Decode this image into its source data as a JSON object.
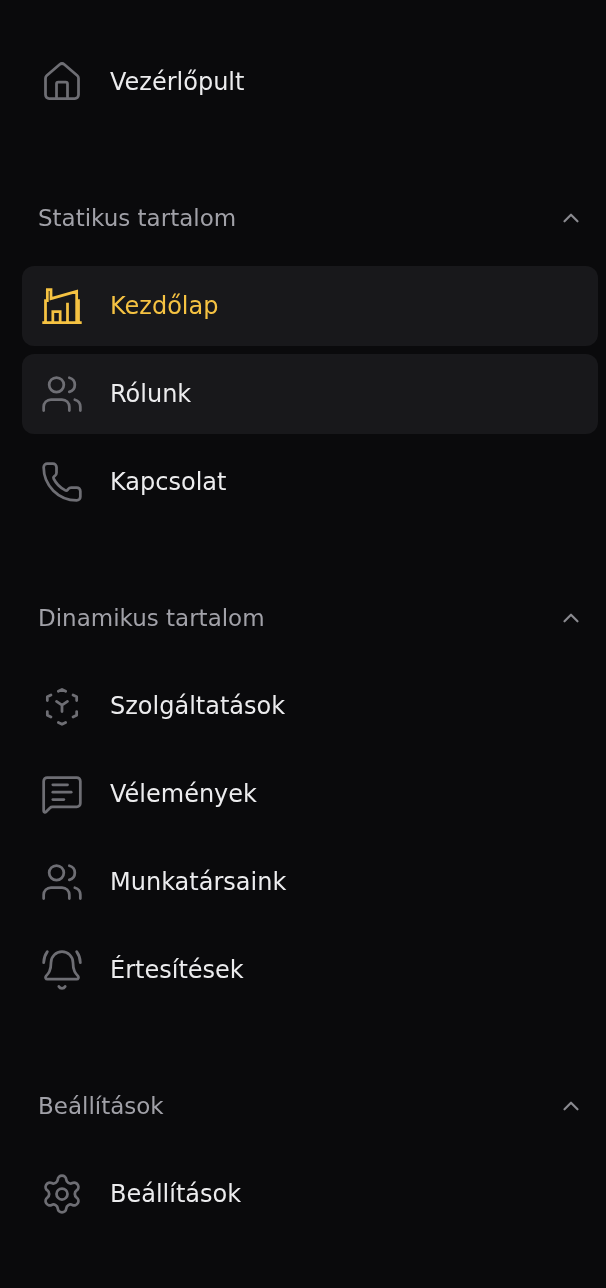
{
  "top_item": {
    "label": "Vezérlőpult",
    "selected": false
  },
  "sections": [
    {
      "title": "Statikus tartalom",
      "expanded": true,
      "items": [
        {
          "label": "Kezdőlap",
          "selected": true,
          "hovered": false
        },
        {
          "label": "Rólunk",
          "selected": false,
          "hovered": true
        },
        {
          "label": "Kapcsolat",
          "selected": false,
          "hovered": false
        }
      ]
    },
    {
      "title": "Dinamikus tartalom",
      "expanded": true,
      "items": [
        {
          "label": "Szolgáltatások",
          "selected": false,
          "hovered": false
        },
        {
          "label": "Vélemények",
          "selected": false,
          "hovered": false
        },
        {
          "label": "Munkatársaink",
          "selected": false,
          "hovered": false
        },
        {
          "label": "Értesítések",
          "selected": false,
          "hovered": false
        }
      ]
    },
    {
      "title": "Beállítások",
      "expanded": true,
      "items": [
        {
          "label": "Beállítások",
          "selected": false,
          "hovered": false
        }
      ]
    }
  ]
}
